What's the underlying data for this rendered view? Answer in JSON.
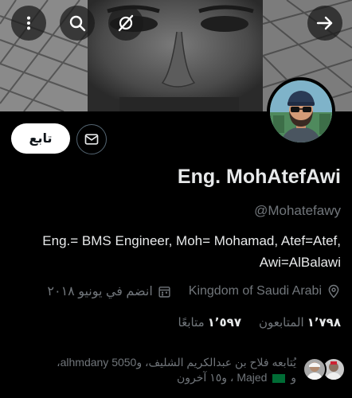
{
  "header": {
    "back_icon": "arrow-right-icon",
    "hide_icon": "eye-slash-icon",
    "search_icon": "search-icon",
    "more_icon": "more-vertical-icon"
  },
  "actions": {
    "follow_label": "تابع",
    "message_icon": "envelope-icon"
  },
  "profile": {
    "display_name": "Eng. MohAtefAwi",
    "handle": "@Mohatefawy",
    "bio_line1": "Eng.= BMS Engineer, Moh= Mohamad, Atef=Atef,",
    "bio_line2": "Awi=AlBalawi",
    "location": "Kingdom of Saudi Arabi",
    "joined": "انضم في يونيو ٢٠١٨"
  },
  "stats": {
    "followers_count": "١٬٧٩٨",
    "followers_label": "المتابعون",
    "following_count": "١٬٥٩٧",
    "following_label": "متابعًا"
  },
  "followed_by": {
    "line1": "يُتابعه فلاح بن عبدالكريم الشليف، و5050 alhmdany،",
    "line2_prefix": "و",
    "line2_name": "Majed",
    "line2_suffix": "، و١٥ آخرون"
  },
  "colors": {
    "background": "#000000",
    "text_primary": "#e7e9ea",
    "text_secondary": "#71767b",
    "border": "#536471"
  }
}
